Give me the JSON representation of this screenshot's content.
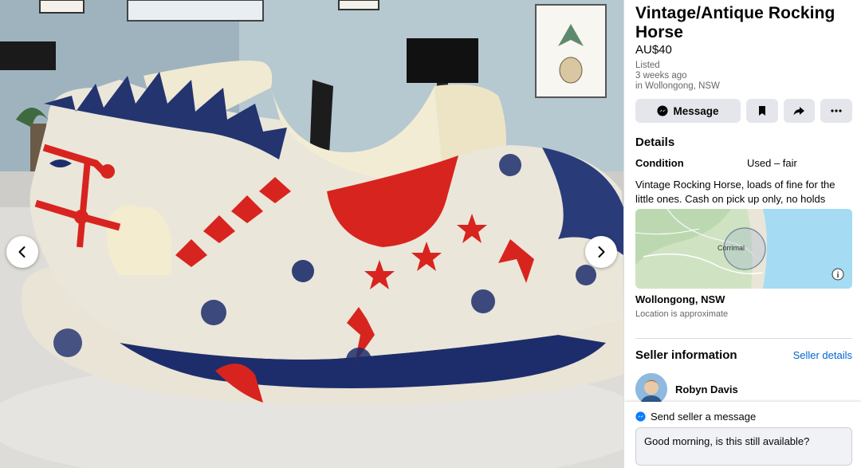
{
  "listing": {
    "title": "Vintage/Antique Rocking Horse",
    "price": "AU$40",
    "listed_label": "Listed",
    "listed_ago": "3 weeks ago",
    "location_line": "in Wollongong, NSW"
  },
  "actions": {
    "message_label": "Message",
    "icons": [
      "messenger-icon",
      "bookmark-icon",
      "share-icon",
      "more-icon"
    ]
  },
  "details": {
    "heading": "Details",
    "condition_label": "Condition",
    "condition_value": "Used – fair",
    "description": "Vintage Rocking Horse, loads of fine for the little ones. Cash on pick up only, no holds"
  },
  "map": {
    "place_label": "Corrimal",
    "location": "Wollongong, NSW",
    "approx_note": "Location is approximate"
  },
  "seller": {
    "heading": "Seller information",
    "details_link": "Seller details",
    "name": "Robyn Davis"
  },
  "send": {
    "label": "Send seller a message",
    "input_value": "Good morning, is this still available?"
  },
  "colors": {
    "accent": "#0064d1",
    "button_bg": "#e4e6eb",
    "horse_red": "#d8241f",
    "horse_blue": "#1d2d6b"
  }
}
